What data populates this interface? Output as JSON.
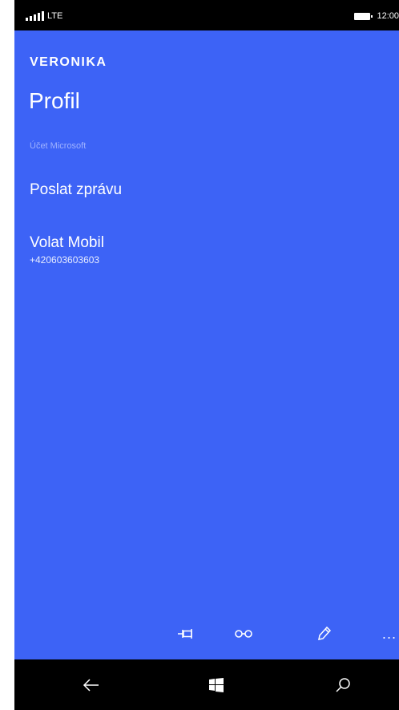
{
  "status_bar": {
    "network": "LTE",
    "time": "12:00"
  },
  "contact": {
    "name": "VERONIKA"
  },
  "page": {
    "title": "Profil"
  },
  "account": {
    "label": "Účet Microsoft"
  },
  "actions": [
    {
      "label": "Poslat zprávu",
      "subtext": ""
    },
    {
      "label": "Volat Mobil",
      "subtext": "+420603603603"
    }
  ],
  "app_bar": {
    "icons": [
      "pin-icon",
      "link-icon",
      "edit-icon",
      "more-icon"
    ],
    "more_label": "..."
  },
  "nav_bar": {
    "icons": [
      "back-arrow-icon",
      "windows-logo-icon",
      "search-icon"
    ]
  },
  "colors": {
    "background": "#3d63f6",
    "status_bar": "#000000",
    "text": "#ffffff",
    "account_text": "#9fb2ff"
  }
}
